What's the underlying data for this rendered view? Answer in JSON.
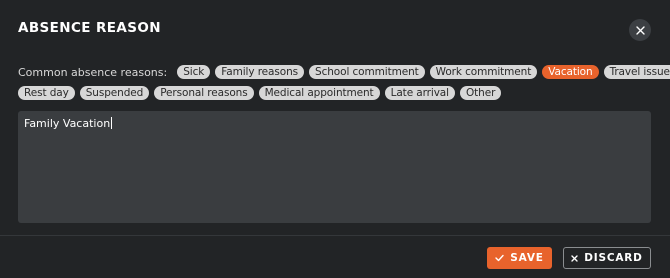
{
  "dialog": {
    "title": "ABSENCE REASON"
  },
  "reasons": {
    "label": "Common absence reasons:",
    "selected": "Vacation",
    "row1": [
      {
        "label": "Sick",
        "active": false
      },
      {
        "label": "Family reasons",
        "active": false
      },
      {
        "label": "School commitment",
        "active": false
      },
      {
        "label": "Work commitment",
        "active": false
      },
      {
        "label": "Vacation",
        "active": true
      },
      {
        "label": "Travel issues",
        "active": false
      }
    ],
    "row2": [
      {
        "label": "Rest day",
        "active": false
      },
      {
        "label": "Suspended",
        "active": false
      },
      {
        "label": "Personal reasons",
        "active": false
      },
      {
        "label": "Medical appointment",
        "active": false
      },
      {
        "label": "Late arrival",
        "active": false
      },
      {
        "label": "Other",
        "active": false
      }
    ]
  },
  "textarea": {
    "value": "Family Vacation"
  },
  "actions": {
    "save_label": "SAVE",
    "discard_label": "DISCARD"
  },
  "icons": {
    "close": "close-icon",
    "save": "check-icon",
    "discard": "x-icon"
  },
  "colors": {
    "background": "#222426",
    "accent": "#e8632c",
    "chip": "#d7d7d7",
    "textarea": "#3a3d40"
  }
}
